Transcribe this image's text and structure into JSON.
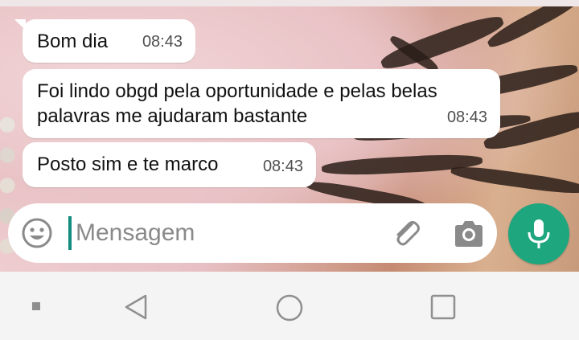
{
  "messages": [
    {
      "text": "Bom dia",
      "time": "08:43"
    },
    {
      "text_line1": "Foi lindo obgd pela oportunidade e pelas belas",
      "text_line2": "palavras me ajudaram bastante",
      "time": "08:43"
    },
    {
      "text": "Posto sim e te marco",
      "time": "08:43"
    }
  ],
  "composer": {
    "placeholder": "Mensagem",
    "icons": [
      "emoji-icon",
      "paperclip-icon",
      "camera-icon"
    ]
  },
  "mic_button": {
    "icon": "microphone-icon",
    "color": "#1ea67f"
  },
  "navbar": {
    "icons": [
      "square-dot-icon",
      "back-triangle-icon",
      "home-circle-icon",
      "recents-square-icon"
    ]
  },
  "colors": {
    "bubble": "#ffffff",
    "accent": "#128c7e",
    "navbar": "#f4f4f4"
  }
}
